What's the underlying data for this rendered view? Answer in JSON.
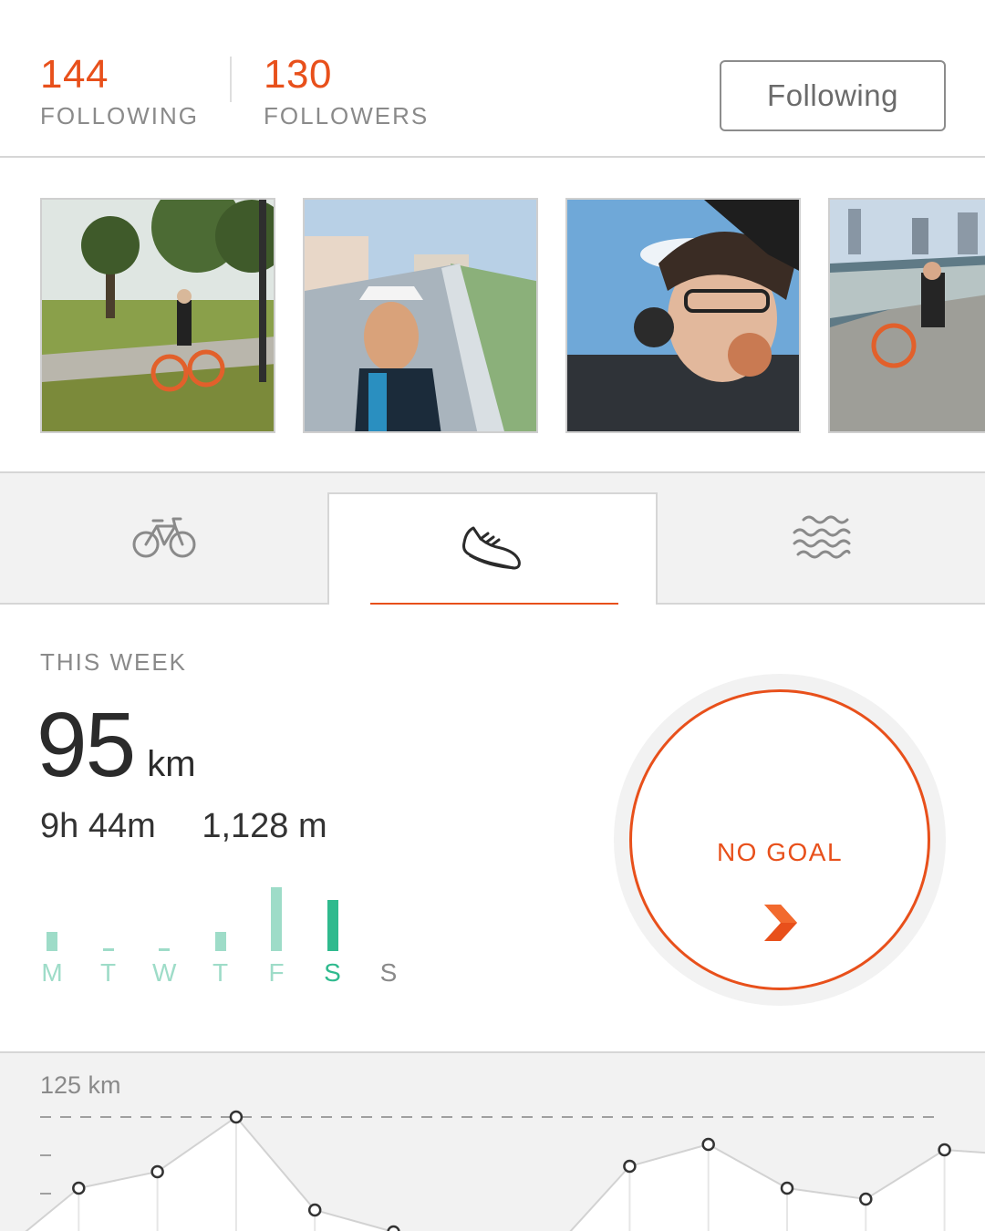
{
  "profile": {
    "following_count": "144",
    "following_label": "FOLLOWING",
    "followers_count": "130",
    "followers_label": "FOLLOWERS",
    "follow_button": "Following"
  },
  "photos": [
    {
      "alt": "photo-park-bike"
    },
    {
      "alt": "photo-bridge-selfie"
    },
    {
      "alt": "photo-selfie-headphones"
    },
    {
      "alt": "photo-bridge-bike"
    }
  ],
  "tabs": [
    {
      "name": "ride",
      "icon": "bicycle-icon",
      "selected": false
    },
    {
      "name": "run",
      "icon": "running-shoe-icon",
      "selected": true
    },
    {
      "name": "swim",
      "icon": "water-waves-icon",
      "selected": false
    }
  ],
  "week": {
    "title": "THIS WEEK",
    "distance": "95",
    "distance_unit": "km",
    "time": "9h 44m",
    "elevation": "1,128 m",
    "days": [
      "M",
      "T",
      "W",
      "T",
      "F",
      "S",
      "S"
    ],
    "day_levels": [
      0.3,
      0.03,
      0.03,
      0.3,
      1.0,
      0.8,
      0
    ],
    "goal_label": "NO GOAL"
  },
  "colors": {
    "accent": "#e8501b",
    "bar_light": "#9edcc8",
    "bar_active": "#2fba8e"
  },
  "chart_data": {
    "type": "line",
    "ylabel": "125 km",
    "values": [
      1,
      60,
      75,
      125,
      40,
      20,
      1,
      1,
      80,
      100,
      60,
      50,
      95,
      90
    ],
    "highlight_last": true
  }
}
